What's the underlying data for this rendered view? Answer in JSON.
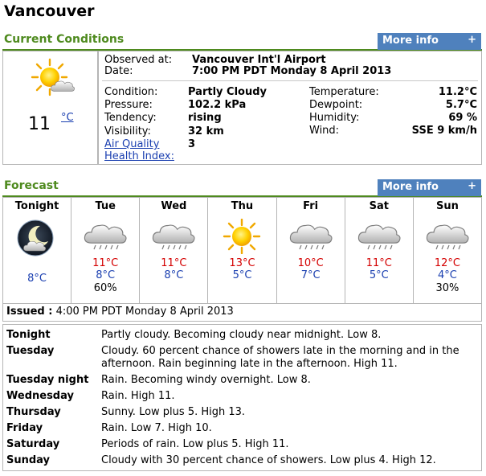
{
  "city": "Vancouver",
  "current": {
    "section_title": "Current Conditions",
    "more_info": "More info",
    "more_icon": "+",
    "temp_value": "11",
    "temp_unit": "°C",
    "observed_label": "Observed at:",
    "observed_value": "Vancouver Int'l Airport",
    "date_label": "Date:",
    "date_value": "7:00 PM PDT Monday 8 April 2013",
    "condition_label": "Condition:",
    "condition_value": "Partly Cloudy",
    "pressure_label": "Pressure:",
    "pressure_value": "102.2 kPa",
    "tendency_label": "Tendency:",
    "tendency_value": "rising",
    "visibility_label": "Visibility:",
    "visibility_value": "32 km",
    "aqhi_label_1": "Air Quality",
    "aqhi_label_2": "Health Index:",
    "aqhi_value": "3",
    "temperature_label": "Temperature:",
    "temperature_value": "11.2°C",
    "dewpoint_label": "Dewpoint:",
    "dewpoint_value": "5.7°C",
    "humidity_label": "Humidity:",
    "humidity_value": "69 %",
    "wind_label": "Wind:",
    "wind_value": "SSE 9 km/h",
    "icon": "partly-cloudy-icon"
  },
  "forecast": {
    "section_title": "Forecast",
    "more_info": "More info",
    "more_icon": "+",
    "days": [
      {
        "name": "Tonight",
        "icon": "night-partly-cloudy-icon",
        "high": "",
        "low": "8°C",
        "pop": ""
      },
      {
        "name": "Tue",
        "icon": "rain-icon",
        "high": "11°C",
        "low": "8°C",
        "pop": "60%"
      },
      {
        "name": "Wed",
        "icon": "rain-icon",
        "high": "11°C",
        "low": "8°C",
        "pop": ""
      },
      {
        "name": "Thu",
        "icon": "sun-icon",
        "high": "13°C",
        "low": "5°C",
        "pop": ""
      },
      {
        "name": "Fri",
        "icon": "rain-icon",
        "high": "10°C",
        "low": "7°C",
        "pop": ""
      },
      {
        "name": "Sat",
        "icon": "rain-icon",
        "high": "11°C",
        "low": "5°C",
        "pop": ""
      },
      {
        "name": "Sun",
        "icon": "rain-icon",
        "high": "12°C",
        "low": "4°C",
        "pop": "30%"
      }
    ],
    "issued_label": "Issued :",
    "issued_value": "4:00 PM PDT Monday 8 April 2013",
    "periods": [
      {
        "name": "Tonight",
        "text": "Partly cloudy. Becoming cloudy near midnight. Low 8."
      },
      {
        "name": "Tuesday",
        "text": "Cloudy. 60 percent chance of showers late in the morning and in the afternoon. Rain beginning late in the afternoon. High 11."
      },
      {
        "name": "Tuesday night",
        "text": "Rain. Becoming windy overnight. Low 8."
      },
      {
        "name": "Wednesday",
        "text": "Rain. High 11."
      },
      {
        "name": "Thursday",
        "text": "Sunny. Low plus 5. High 13."
      },
      {
        "name": "Friday",
        "text": "Rain. Low 7. High 10."
      },
      {
        "name": "Saturday",
        "text": "Periods of rain. Low plus 5. High 11."
      },
      {
        "name": "Sunday",
        "text": "Cloudy with 30 percent chance of showers. Low plus 4. High 12."
      }
    ]
  },
  "colors": {
    "section_green": "#4e8a1e",
    "button_blue": "#4f81bd",
    "high_red": "#d40000",
    "low_blue": "#1a3fb0"
  }
}
